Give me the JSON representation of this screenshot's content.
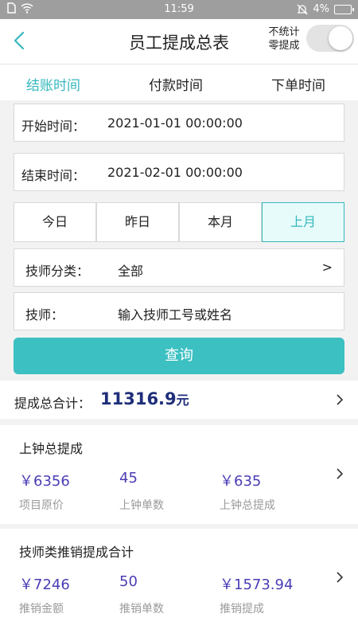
{
  "status_bar": {
    "time": "11:59",
    "battery": "4%"
  },
  "header": {
    "title": "员工提成总表",
    "toggle_label_line1": "不统计",
    "toggle_label_line2": "零提成",
    "toggle_on": false
  },
  "tabs": [
    {
      "label": "结账时间",
      "active": true
    },
    {
      "label": "付款时间",
      "active": false
    },
    {
      "label": "下单时间",
      "active": false
    }
  ],
  "filters": {
    "start_label": "开始时间：",
    "start_value": "2021-01-01 00:00:00",
    "end_label": "结束时间：",
    "end_value": "2021-02-01 00:00:00",
    "quick_ranges": [
      {
        "label": "今日",
        "active": false
      },
      {
        "label": "昨日",
        "active": false
      },
      {
        "label": "本月",
        "active": false
      },
      {
        "label": "上月",
        "active": true
      }
    ],
    "category_label": "技师分类：",
    "category_value": "全部",
    "category_arrow": ">",
    "tech_label": "技师：",
    "tech_placeholder": "输入技师工号或姓名",
    "query_label": "查询"
  },
  "summary": {
    "label": "提成总合计：",
    "amount": "11316.9",
    "unit": "元"
  },
  "cards": [
    {
      "title": "上钟总提成",
      "stats": [
        {
          "value": "￥6356",
          "label": "项目原价"
        },
        {
          "value": "45",
          "label": "上钟单数"
        },
        {
          "value": "￥635",
          "label": "上钟总提成"
        }
      ]
    },
    {
      "title": "技师类推销提成合计",
      "stats": [
        {
          "value": "￥7246",
          "label": "推销金额"
        },
        {
          "value": "50",
          "label": "推销单数"
        },
        {
          "value": "￥1573.94",
          "label": "推销提成"
        }
      ]
    }
  ],
  "colors": {
    "accent": "#35b7bd",
    "button": "#3cc0c2",
    "amount": "#1f2e7a",
    "stat_value": "#4a3db5"
  }
}
